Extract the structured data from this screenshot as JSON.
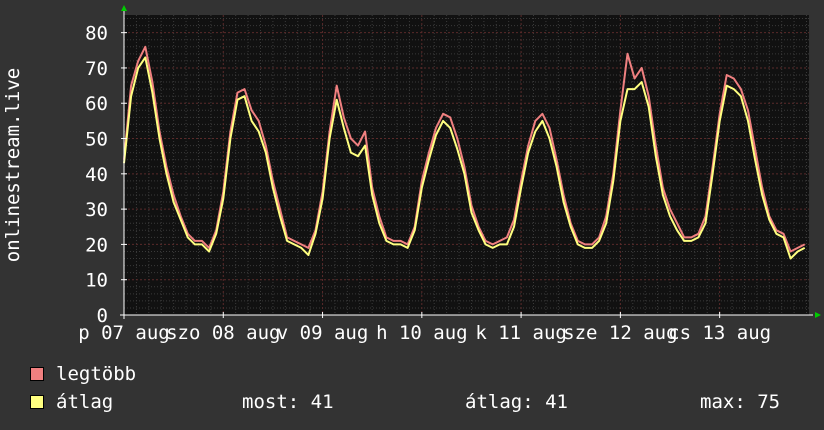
{
  "chart_data": {
    "type": "line",
    "ylabel": "onlinestream.live",
    "ylim": [
      0,
      85
    ],
    "yticks": [
      0,
      10,
      20,
      30,
      40,
      50,
      60,
      70,
      80
    ],
    "grid": true,
    "x_day_labels": [
      "p 07 aug",
      "szo 08 aug",
      "v 09 aug",
      "h 10 aug",
      "k 11 aug",
      "sze 12 aug",
      "cs 13 aug"
    ],
    "x_label_positions_days": [
      0,
      1,
      2,
      3,
      4,
      5,
      6
    ],
    "x_days_span": [
      0,
      6.9
    ],
    "series": [
      {
        "name": "legtöbb",
        "color": "#f08080",
        "hourly": [
          44,
          65,
          72,
          76,
          66,
          52,
          42,
          34,
          28,
          23,
          21,
          21,
          19,
          24,
          35,
          52,
          63,
          64,
          58,
          55,
          48,
          38,
          30,
          22,
          21,
          20,
          19,
          24,
          35,
          52,
          65,
          56,
          50,
          48,
          52,
          36,
          28,
          22,
          21,
          21,
          20,
          25,
          38,
          46,
          53,
          57,
          56,
          50,
          42,
          31,
          25,
          21,
          20,
          21,
          22,
          27,
          38,
          48,
          55,
          57,
          53,
          44,
          34,
          26,
          21,
          20,
          20,
          22,
          28,
          40,
          58,
          74,
          67,
          70,
          62,
          48,
          36,
          30,
          26,
          22,
          22,
          23,
          28,
          42,
          57,
          68,
          67,
          64,
          58,
          47,
          36,
          28,
          24,
          23,
          18,
          19,
          20,
          29,
          41
        ]
      },
      {
        "name": "átlag",
        "color": "#ffff80",
        "hourly": [
          43,
          62,
          70,
          73,
          63,
          50,
          40,
          32,
          27,
          22,
          20,
          20,
          18,
          23,
          33,
          50,
          61,
          62,
          55,
          52,
          46,
          36,
          28,
          21,
          20,
          19,
          17,
          23,
          33,
          50,
          61,
          53,
          46,
          45,
          48,
          34,
          26,
          21,
          20,
          20,
          19,
          24,
          36,
          44,
          51,
          55,
          53,
          47,
          40,
          29,
          24,
          20,
          19,
          20,
          20,
          25,
          36,
          46,
          52,
          55,
          50,
          42,
          32,
          25,
          20,
          19,
          19,
          21,
          26,
          38,
          55,
          64,
          64,
          66,
          59,
          45,
          34,
          28,
          24,
          21,
          21,
          22,
          26,
          40,
          55,
          65,
          64,
          62,
          55,
          44,
          34,
          27,
          23,
          22,
          16,
          18,
          19,
          27,
          40
        ]
      }
    ]
  },
  "legend": {
    "items": [
      {
        "label": "legtöbb",
        "color": "#f08080"
      },
      {
        "label": "átlag",
        "color": "#ffff80"
      }
    ],
    "stats": {
      "now_label": "most:",
      "now_value": "41",
      "avg_label": "átlag:",
      "avg_value": "41",
      "max_label": "max:",
      "max_value": "75"
    }
  },
  "colors": {
    "background": "#333333",
    "plot_background": "#111111",
    "grid_minor": "#3a3a3a",
    "grid_major": "#5a2a2a",
    "axis": "#ffffff",
    "arrow": "#00cc00"
  }
}
